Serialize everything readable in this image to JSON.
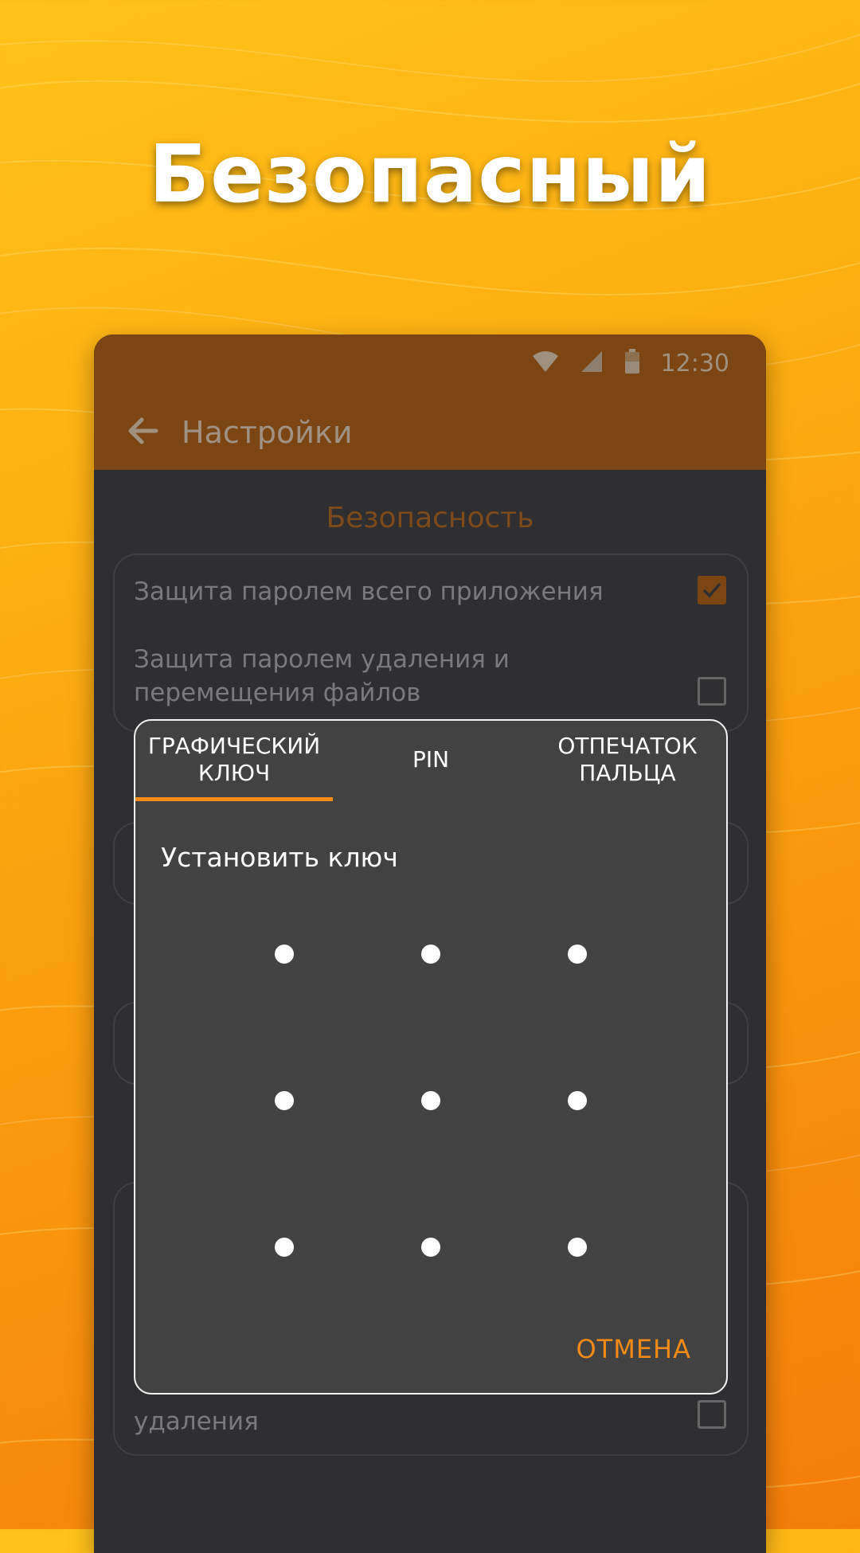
{
  "promo": {
    "headline": "Безопасный"
  },
  "status_bar": {
    "time": "12:30",
    "icons": [
      "wifi-icon",
      "signal-icon",
      "battery-icon"
    ]
  },
  "toolbar": {
    "back_icon": "arrow-left-icon",
    "title": "Настройки"
  },
  "settings": {
    "section_title": "Безопасность",
    "items": [
      {
        "label": "Защита паролем всего приложения",
        "checked": true
      },
      {
        "label_line1": "Защита паролем удаления и",
        "label_line2": "перемещения файлов",
        "checked": false
      },
      {
        "label_partial": "удаления",
        "checked": false
      }
    ]
  },
  "dialog": {
    "tabs": [
      {
        "line1": "ГРАФИЧЕСКИЙ",
        "line2": "КЛЮЧ",
        "selected": true
      },
      {
        "line1": "PIN",
        "selected": false
      },
      {
        "line1": "ОТПЕЧАТОК",
        "line2": "ПАЛЬЦА",
        "selected": false
      }
    ],
    "title": "Установить ключ",
    "cancel_label": "ОТМЕНА"
  },
  "colors": {
    "accent": "#f28a18",
    "appbar": "#7c4614",
    "background": "#2f2e30",
    "dialog": "#424242"
  }
}
